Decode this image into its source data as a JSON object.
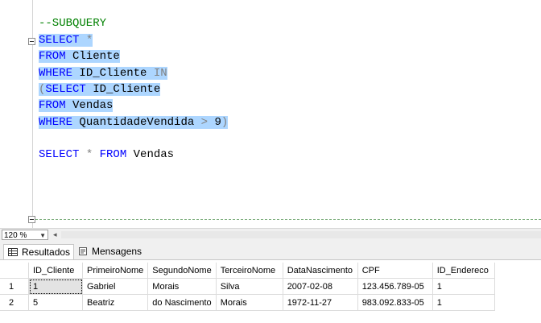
{
  "editor": {
    "lines": [
      [
        {
          "t": "--SUBQUERY",
          "c": "cm",
          "s": false
        }
      ],
      [
        {
          "t": "SELECT ",
          "c": "kw",
          "s": true
        },
        {
          "t": "*",
          "c": "op",
          "s": true
        }
      ],
      [
        {
          "t": "FROM ",
          "c": "kw",
          "s": true
        },
        {
          "t": "Cliente",
          "c": "id",
          "s": true
        }
      ],
      [
        {
          "t": "WHERE ",
          "c": "kw",
          "s": true
        },
        {
          "t": "ID_Cliente ",
          "c": "id",
          "s": true
        },
        {
          "t": "IN",
          "c": "op",
          "s": true
        }
      ],
      [
        {
          "t": "(",
          "c": "op",
          "s": true
        },
        {
          "t": "SELECT ",
          "c": "kw",
          "s": true
        },
        {
          "t": "ID_Cliente",
          "c": "id",
          "s": true
        }
      ],
      [
        {
          "t": "FROM ",
          "c": "kw",
          "s": true
        },
        {
          "t": "Vendas",
          "c": "id",
          "s": true
        }
      ],
      [
        {
          "t": "WHERE ",
          "c": "kw",
          "s": true
        },
        {
          "t": "QuantidadeVendida ",
          "c": "id",
          "s": true
        },
        {
          "t": "> ",
          "c": "op",
          "s": true
        },
        {
          "t": "9",
          "c": "num",
          "s": true
        },
        {
          "t": ")",
          "c": "op",
          "s": true
        }
      ],
      [],
      [
        {
          "t": "SELECT ",
          "c": "kw",
          "s": false
        },
        {
          "t": "* ",
          "c": "op",
          "s": false
        },
        {
          "t": "FROM ",
          "c": "kw",
          "s": false
        },
        {
          "t": "Vendas",
          "c": "id",
          "s": false
        }
      ]
    ]
  },
  "zoom": {
    "value": "120 %"
  },
  "tabs": {
    "results": "Resultados",
    "messages": "Mensagens"
  },
  "grid": {
    "columns": [
      "ID_Cliente",
      "PrimeiroNome",
      "SegundoNome",
      "TerceiroNome",
      "DataNascimento",
      "CPF",
      "ID_Endereco"
    ],
    "rows": [
      {
        "num": "1",
        "cells": [
          "1",
          "Gabriel",
          "Morais",
          "Silva",
          "2007-02-08",
          "123.456.789-05",
          "1"
        ]
      },
      {
        "num": "2",
        "cells": [
          "5",
          "Beatriz",
          "do Nascimento",
          "Morais",
          "1972-11-27",
          "983.092.833-05",
          "1"
        ]
      }
    ]
  },
  "colors": {
    "selection": "#add6ff",
    "keyword": "#0000ff",
    "comment": "#008000",
    "operator": "#808080"
  }
}
